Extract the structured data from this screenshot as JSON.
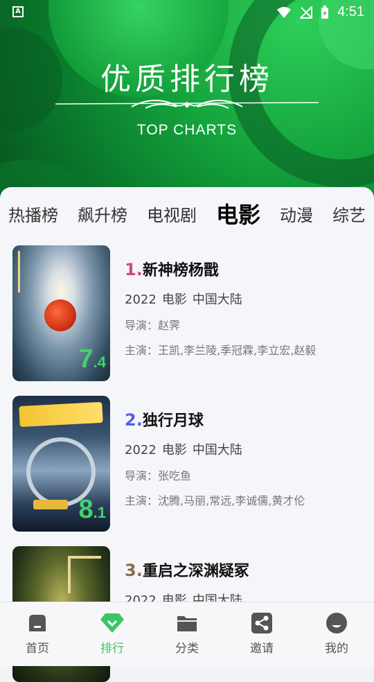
{
  "status": {
    "time": "4:51",
    "app_badge": "A"
  },
  "header": {
    "title": "优质排行榜",
    "subtitle": "TOP CHARTS"
  },
  "tabs": [
    {
      "label": "热播榜",
      "active": false
    },
    {
      "label": "飙升榜",
      "active": false
    },
    {
      "label": "电视剧",
      "active": false
    },
    {
      "label": "电影",
      "active": true
    },
    {
      "label": "动漫",
      "active": false
    },
    {
      "label": "综艺",
      "active": false
    }
  ],
  "items": [
    {
      "rank": "1.",
      "rank_color": "#d6457f",
      "title": "新神榜杨戬",
      "year": "2022",
      "type": "电影",
      "region": "中国大陆",
      "director": "导演：赵霁",
      "cast": "主演：王凯,李兰陵,季冠霖,李立宏,赵毅",
      "score_int": "7",
      "score_dec": ".4"
    },
    {
      "rank": "2.",
      "rank_color": "#5a5ee6",
      "title": "独行月球",
      "year": "2022",
      "type": "电影",
      "region": "中国大陆",
      "director": "导演：张吃鱼",
      "cast": "主演：沈腾,马丽,常远,李诚儒,黄才伦",
      "score_int": "8",
      "score_dec": ".1"
    },
    {
      "rank": "3.",
      "rank_color": "#8b6a4e",
      "title": "重启之深渊疑冢",
      "year": "2022",
      "type": "电影",
      "region": "中国大陆"
    }
  ],
  "nav": [
    {
      "label": "首页",
      "icon": "home-icon",
      "active": false
    },
    {
      "label": "排行",
      "icon": "diamond-icon",
      "active": true
    },
    {
      "label": "分类",
      "icon": "folder-icon",
      "active": false
    },
    {
      "label": "邀请",
      "icon": "share-icon",
      "active": false
    },
    {
      "label": "我的",
      "icon": "user-icon",
      "active": false
    }
  ],
  "colors": {
    "accent": "#3cc665",
    "score": "#3fd46a"
  }
}
